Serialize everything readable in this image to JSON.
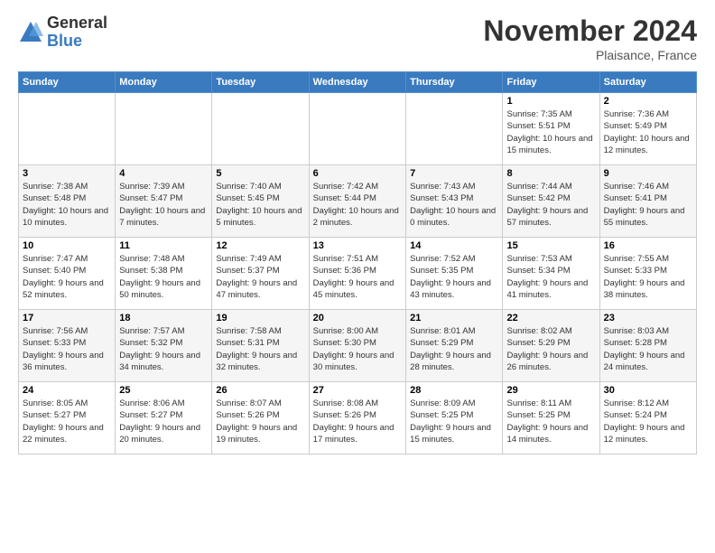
{
  "logo": {
    "general": "General",
    "blue": "Blue"
  },
  "title": "November 2024",
  "location": "Plaisance, France",
  "days_of_week": [
    "Sunday",
    "Monday",
    "Tuesday",
    "Wednesday",
    "Thursday",
    "Friday",
    "Saturday"
  ],
  "weeks": [
    [
      {
        "day": "",
        "info": ""
      },
      {
        "day": "",
        "info": ""
      },
      {
        "day": "",
        "info": ""
      },
      {
        "day": "",
        "info": ""
      },
      {
        "day": "",
        "info": ""
      },
      {
        "day": "1",
        "info": "Sunrise: 7:35 AM\nSunset: 5:51 PM\nDaylight: 10 hours and 15 minutes."
      },
      {
        "day": "2",
        "info": "Sunrise: 7:36 AM\nSunset: 5:49 PM\nDaylight: 10 hours and 12 minutes."
      }
    ],
    [
      {
        "day": "3",
        "info": "Sunrise: 7:38 AM\nSunset: 5:48 PM\nDaylight: 10 hours and 10 minutes."
      },
      {
        "day": "4",
        "info": "Sunrise: 7:39 AM\nSunset: 5:47 PM\nDaylight: 10 hours and 7 minutes."
      },
      {
        "day": "5",
        "info": "Sunrise: 7:40 AM\nSunset: 5:45 PM\nDaylight: 10 hours and 5 minutes."
      },
      {
        "day": "6",
        "info": "Sunrise: 7:42 AM\nSunset: 5:44 PM\nDaylight: 10 hours and 2 minutes."
      },
      {
        "day": "7",
        "info": "Sunrise: 7:43 AM\nSunset: 5:43 PM\nDaylight: 10 hours and 0 minutes."
      },
      {
        "day": "8",
        "info": "Sunrise: 7:44 AM\nSunset: 5:42 PM\nDaylight: 9 hours and 57 minutes."
      },
      {
        "day": "9",
        "info": "Sunrise: 7:46 AM\nSunset: 5:41 PM\nDaylight: 9 hours and 55 minutes."
      }
    ],
    [
      {
        "day": "10",
        "info": "Sunrise: 7:47 AM\nSunset: 5:40 PM\nDaylight: 9 hours and 52 minutes."
      },
      {
        "day": "11",
        "info": "Sunrise: 7:48 AM\nSunset: 5:38 PM\nDaylight: 9 hours and 50 minutes."
      },
      {
        "day": "12",
        "info": "Sunrise: 7:49 AM\nSunset: 5:37 PM\nDaylight: 9 hours and 47 minutes."
      },
      {
        "day": "13",
        "info": "Sunrise: 7:51 AM\nSunset: 5:36 PM\nDaylight: 9 hours and 45 minutes."
      },
      {
        "day": "14",
        "info": "Sunrise: 7:52 AM\nSunset: 5:35 PM\nDaylight: 9 hours and 43 minutes."
      },
      {
        "day": "15",
        "info": "Sunrise: 7:53 AM\nSunset: 5:34 PM\nDaylight: 9 hours and 41 minutes."
      },
      {
        "day": "16",
        "info": "Sunrise: 7:55 AM\nSunset: 5:33 PM\nDaylight: 9 hours and 38 minutes."
      }
    ],
    [
      {
        "day": "17",
        "info": "Sunrise: 7:56 AM\nSunset: 5:33 PM\nDaylight: 9 hours and 36 minutes."
      },
      {
        "day": "18",
        "info": "Sunrise: 7:57 AM\nSunset: 5:32 PM\nDaylight: 9 hours and 34 minutes."
      },
      {
        "day": "19",
        "info": "Sunrise: 7:58 AM\nSunset: 5:31 PM\nDaylight: 9 hours and 32 minutes."
      },
      {
        "day": "20",
        "info": "Sunrise: 8:00 AM\nSunset: 5:30 PM\nDaylight: 9 hours and 30 minutes."
      },
      {
        "day": "21",
        "info": "Sunrise: 8:01 AM\nSunset: 5:29 PM\nDaylight: 9 hours and 28 minutes."
      },
      {
        "day": "22",
        "info": "Sunrise: 8:02 AM\nSunset: 5:29 PM\nDaylight: 9 hours and 26 minutes."
      },
      {
        "day": "23",
        "info": "Sunrise: 8:03 AM\nSunset: 5:28 PM\nDaylight: 9 hours and 24 minutes."
      }
    ],
    [
      {
        "day": "24",
        "info": "Sunrise: 8:05 AM\nSunset: 5:27 PM\nDaylight: 9 hours and 22 minutes."
      },
      {
        "day": "25",
        "info": "Sunrise: 8:06 AM\nSunset: 5:27 PM\nDaylight: 9 hours and 20 minutes."
      },
      {
        "day": "26",
        "info": "Sunrise: 8:07 AM\nSunset: 5:26 PM\nDaylight: 9 hours and 19 minutes."
      },
      {
        "day": "27",
        "info": "Sunrise: 8:08 AM\nSunset: 5:26 PM\nDaylight: 9 hours and 17 minutes."
      },
      {
        "day": "28",
        "info": "Sunrise: 8:09 AM\nSunset: 5:25 PM\nDaylight: 9 hours and 15 minutes."
      },
      {
        "day": "29",
        "info": "Sunrise: 8:11 AM\nSunset: 5:25 PM\nDaylight: 9 hours and 14 minutes."
      },
      {
        "day": "30",
        "info": "Sunrise: 8:12 AM\nSunset: 5:24 PM\nDaylight: 9 hours and 12 minutes."
      }
    ]
  ]
}
